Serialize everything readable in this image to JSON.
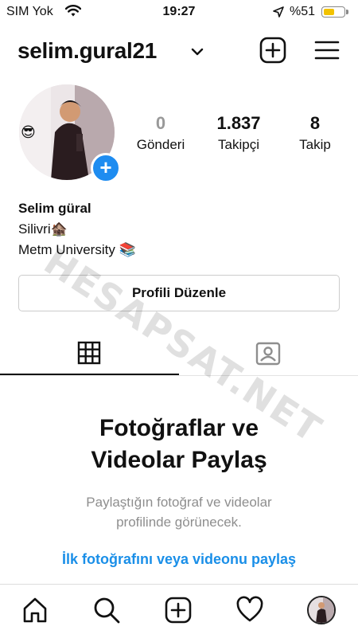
{
  "status_bar": {
    "carrier": "SIM Yok",
    "time": "19:27",
    "battery_text": "%51",
    "battery_level": 0.51,
    "battery_color": "#f2c200"
  },
  "header": {
    "username": "selim.gural21",
    "icons": [
      "chevron-down-icon",
      "new-post-icon",
      "menu-icon"
    ]
  },
  "profile": {
    "stats": [
      {
        "value": "0",
        "label": "Gönderi"
      },
      {
        "value": "1.837",
        "label": "Takipçi"
      },
      {
        "value": "8",
        "label": "Takip"
      }
    ],
    "bio": {
      "name": "Selim güral",
      "line1": "Silivri🏚️",
      "line2": "Metm University 📚"
    },
    "edit_button": "Profili Düzenle",
    "add_badge": "+"
  },
  "tabs": [
    {
      "icon": "grid-icon",
      "active": true
    },
    {
      "icon": "tagged-icon",
      "active": false
    }
  ],
  "empty_state": {
    "title_line1": "Fotoğraflar ve",
    "title_line2": "Videolar Paylaş",
    "subtitle_line1": "Paylaştığın fotoğraf ve videolar",
    "subtitle_line2": "profilinde görünecek.",
    "cta": "İlk fotoğrafını veya videonu paylaş",
    "cta_color": "#1a8fe8"
  },
  "watermark": "HESAPSAT.NET",
  "bottom_nav": [
    "home-icon",
    "search-icon",
    "new-post-icon",
    "activity-heart-icon",
    "profile-avatar"
  ]
}
